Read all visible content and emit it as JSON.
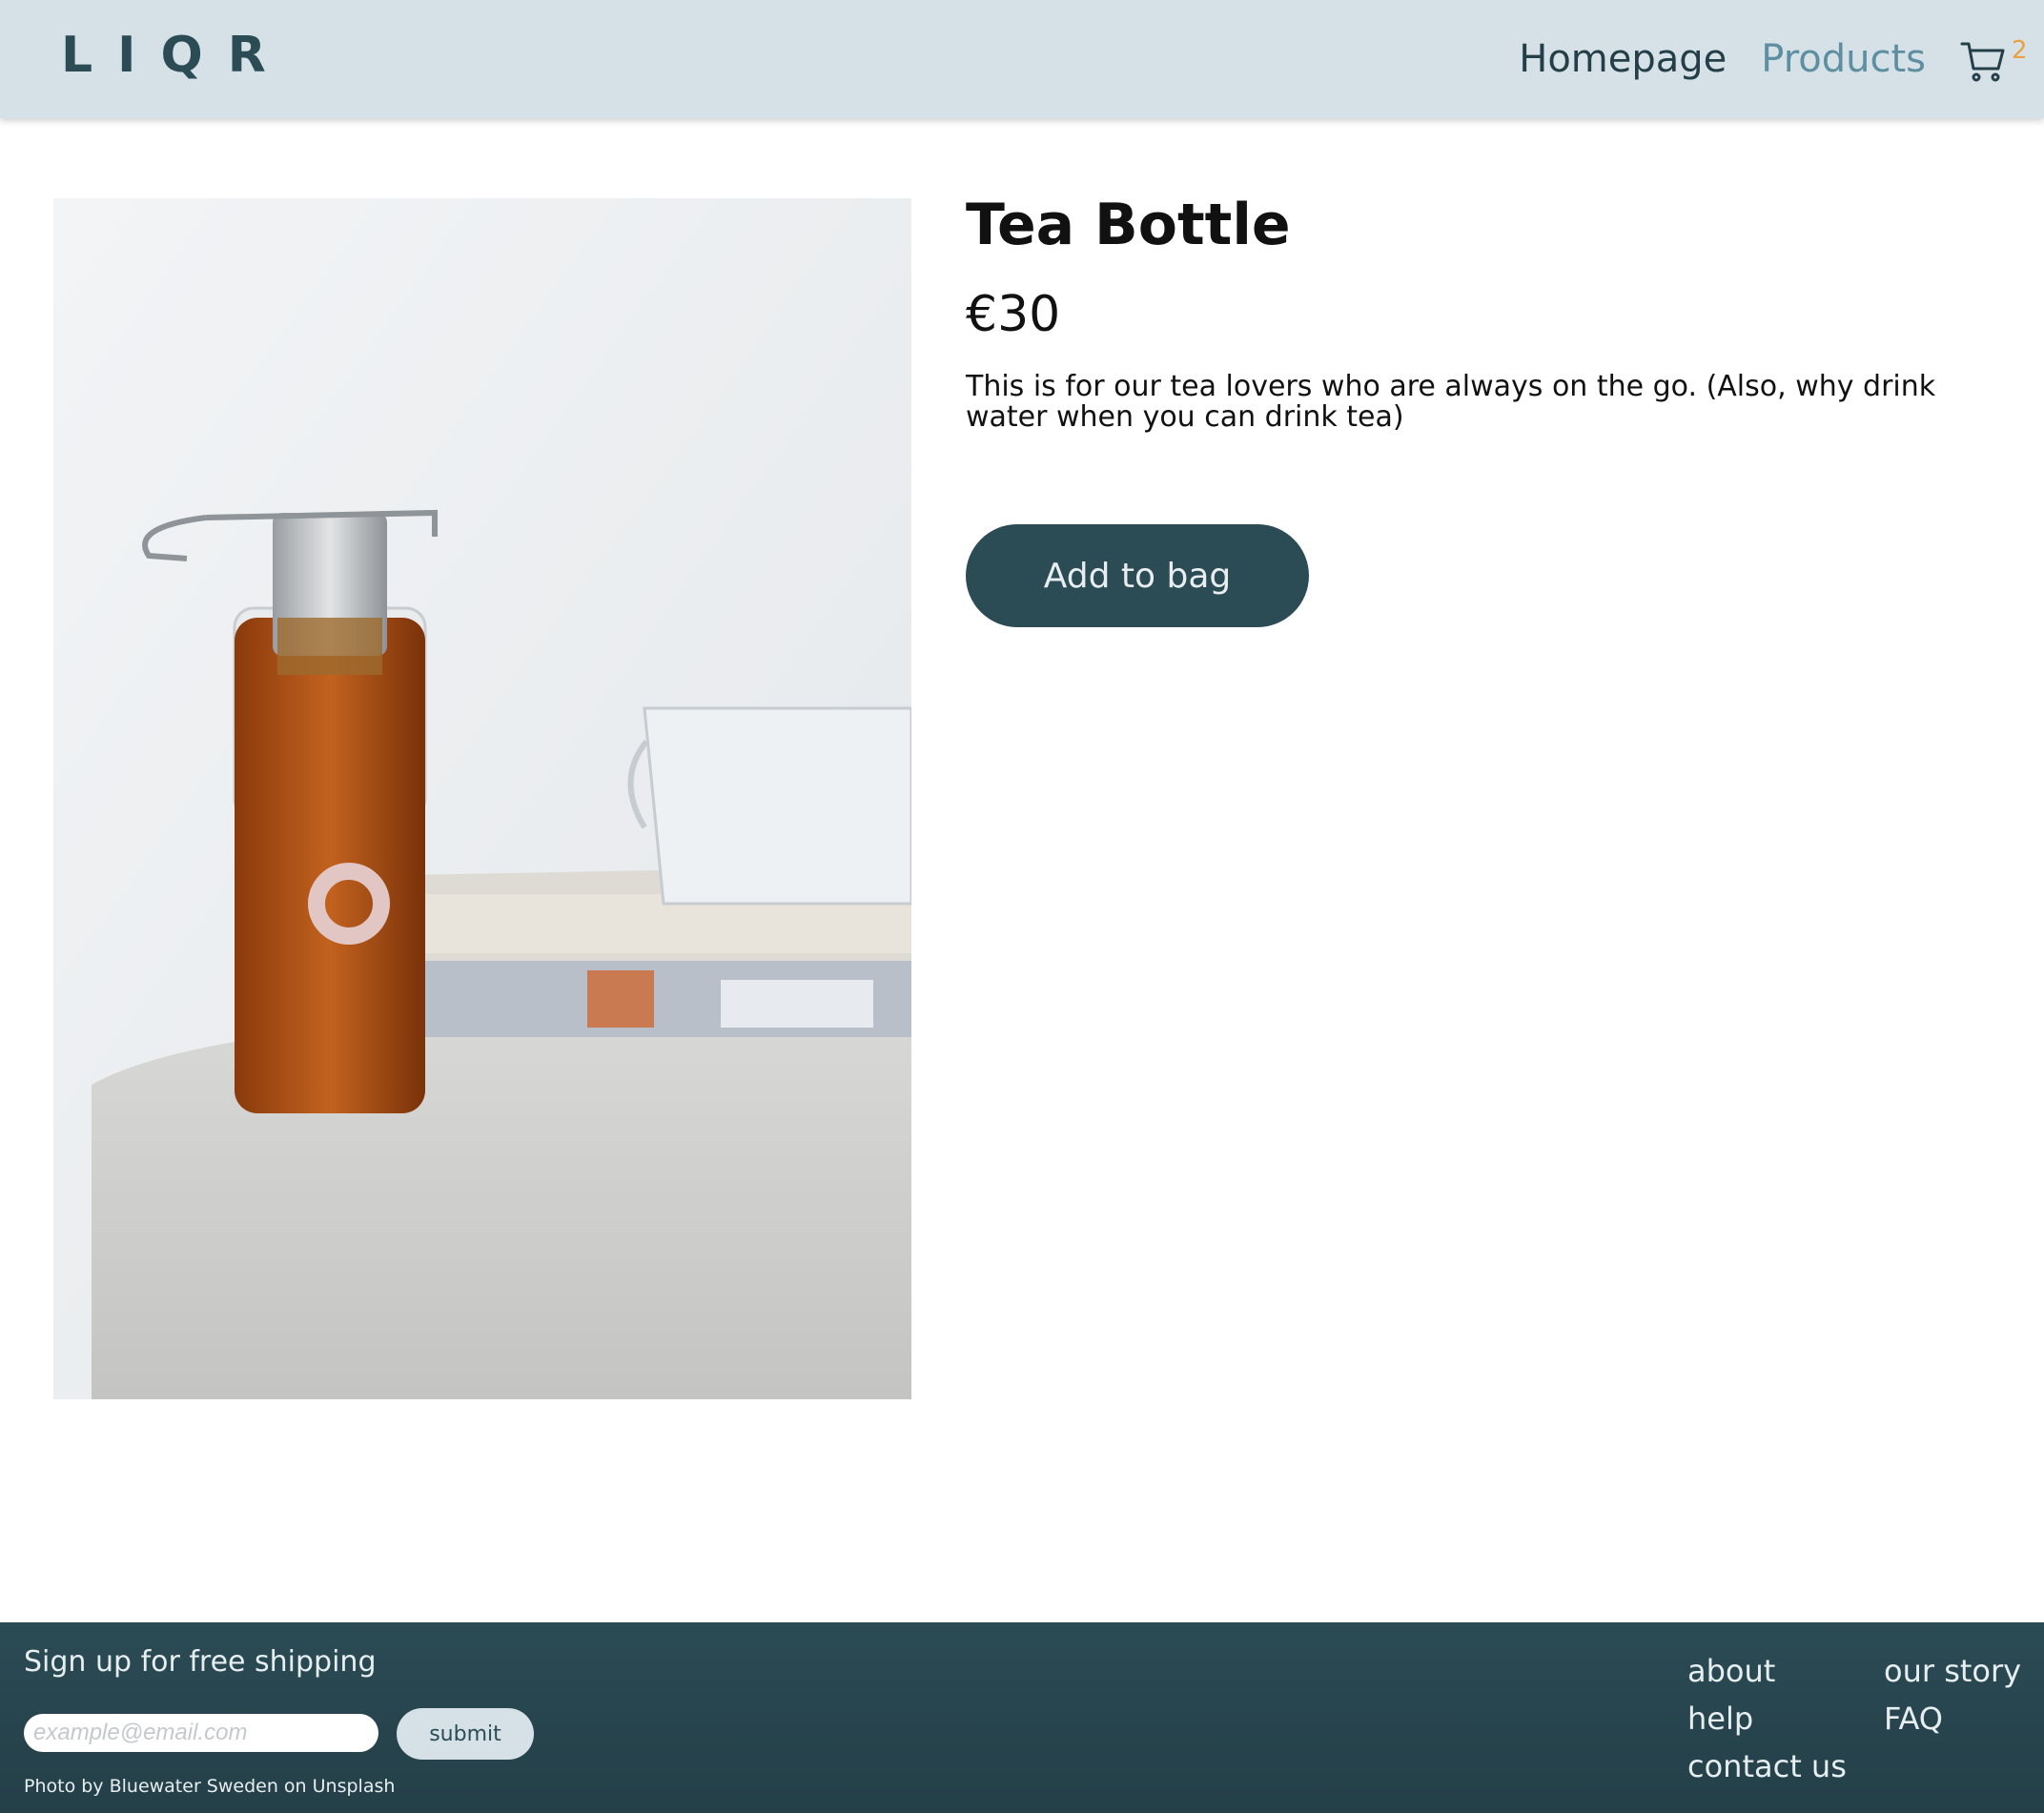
{
  "header": {
    "logo": "LIQR",
    "nav": [
      {
        "label": "Homepage"
      },
      {
        "label": "Products"
      }
    ],
    "active_nav": "Products",
    "cart_count": "2",
    "cart_icon": "shopping-cart-icon",
    "colors": {
      "background": "#d5e1e6",
      "text": "#243f48",
      "active": "#5e8fa0",
      "cart_badge": "#e8a042"
    }
  },
  "product": {
    "image_alt": "tea bottle photo",
    "title": "Tea Bottle",
    "price": "€30",
    "description": "This is for our tea lovers who are always on the go. (Also, why drink water when you can drink tea)",
    "add_button": "Add to bag",
    "colors": {
      "button": "#2b4b55"
    }
  },
  "footer": {
    "signup_title": "Sign up for free shipping",
    "email_placeholder": "example@email.com",
    "submit_label": "submit",
    "photo_credit": "Photo by Bluewater Sweden on Unsplash",
    "links": [
      {
        "label": "about"
      },
      {
        "label": "our story"
      },
      {
        "label": "help"
      },
      {
        "label": "FAQ"
      },
      {
        "label": "contact us"
      }
    ],
    "colors": {
      "background": "#2b4b55"
    }
  }
}
